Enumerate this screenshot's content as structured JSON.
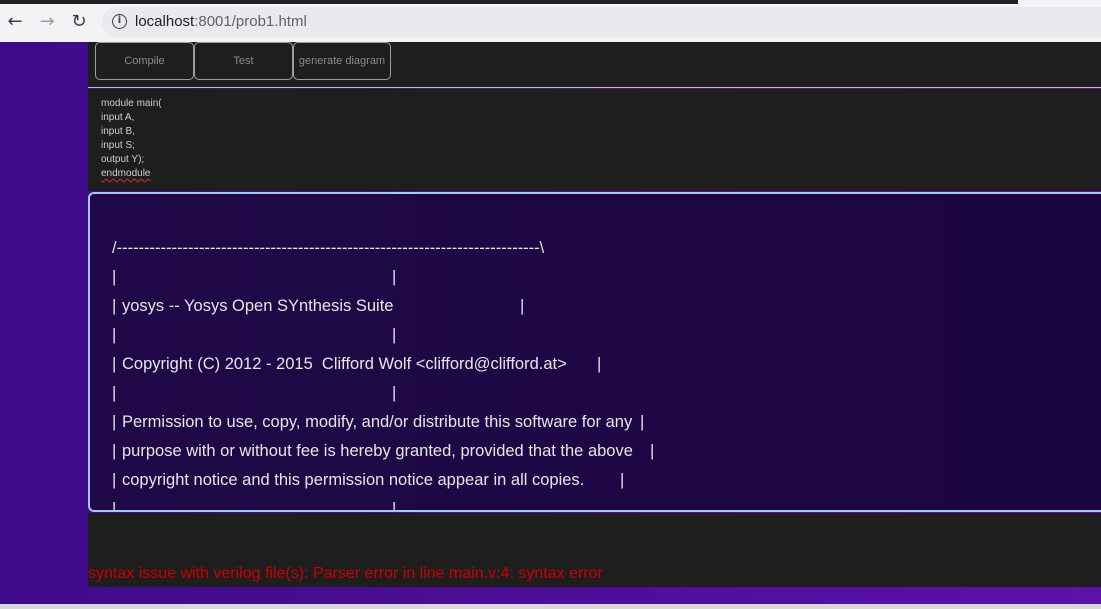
{
  "browser": {
    "url_host": "localhost",
    "url_rest": ":8001/prob1.html"
  },
  "toolbar": {
    "compile_label": "Compile",
    "test_label": "Test",
    "diagram_label": "generate diagram"
  },
  "editor": {
    "lines": [
      "module main(",
      "input A,",
      "input B,",
      "input S;",
      "output Y);",
      "endmodule"
    ]
  },
  "output": {
    "header": "/-----------------------------------------------------------------------------\\",
    "title": "yosys -- Yosys Open SYnthesis Suite",
    "copyright": "Copyright (C) 2012 - 2015  Clifford Wolf <clifford@clifford.at>",
    "perm1": "Permission to use, copy, modify, and/or distribute this software for any",
    "perm2": "purpose with or without fee is hereby granted, provided that the above",
    "perm3": "copyright notice and this permission notice appear in all copies.",
    "bar": "|"
  },
  "error": {
    "message": "syntax issue with verilog file(s): Parser error in line main.v:4: syntax error"
  }
}
